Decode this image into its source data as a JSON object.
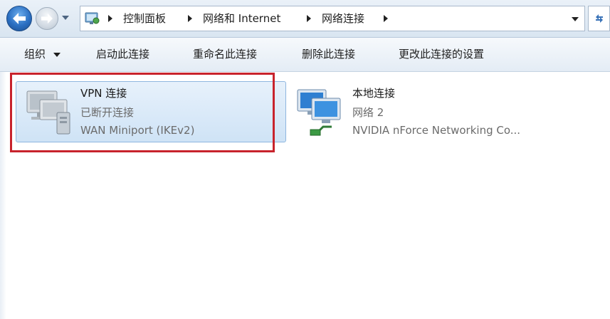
{
  "address_bar": {
    "breadcrumbs": [
      "控制面板",
      "网络和 Internet",
      "网络连接"
    ]
  },
  "toolbar": {
    "organize": "组织",
    "start_connection": "启动此连接",
    "rename_connection": "重命名此连接",
    "delete_connection": "删除此连接",
    "change_settings": "更改此连接的设置"
  },
  "connections": [
    {
      "name": "VPN 连接",
      "status": "已断开连接",
      "device": "WAN Miniport (IKEv2)",
      "icon": "vpn-computer-icon"
    },
    {
      "name": "本地连接",
      "status": "网络  2",
      "device": "NVIDIA nForce Networking Co...",
      "icon": "network-computers-icon"
    }
  ],
  "colors": {
    "highlight_box": "#c8232c",
    "selected_tile": "#cfe3f6",
    "nav_blue": "#2a6fc2"
  }
}
